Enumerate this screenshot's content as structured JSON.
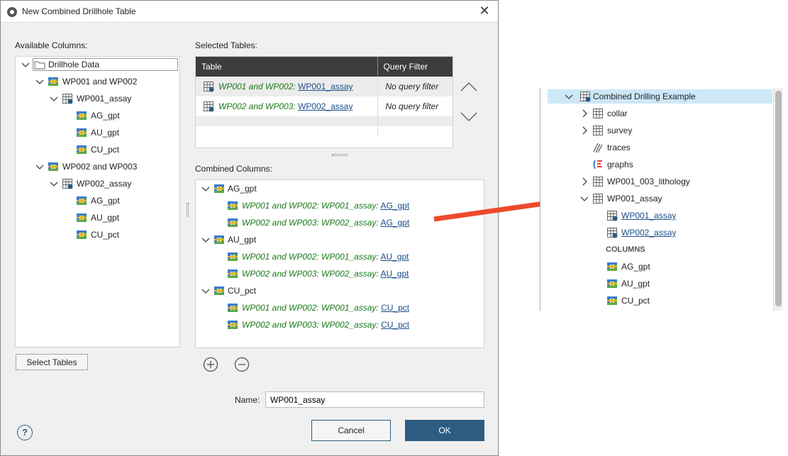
{
  "dialog": {
    "title": "New Combined Drillhole Table",
    "available_label": "Available Columns:",
    "selected_label": "Selected Tables:",
    "combined_label": "Combined Columns:",
    "name_label": "Name:",
    "name_value": "WP001_assay",
    "select_tables": "Select Tables",
    "cancel": "Cancel",
    "ok": "OK",
    "help": "?"
  },
  "available_tree": {
    "root": "Drillhole Data",
    "groups": [
      {
        "label": "WP001 and WP002",
        "table": "WP001_assay",
        "cols": [
          "AG_gpt",
          "AU_gpt",
          "CU_pct"
        ]
      },
      {
        "label": "WP002 and WP003",
        "table": "WP002_assay",
        "cols": [
          "AG_gpt",
          "AU_gpt",
          "CU_pct"
        ]
      }
    ]
  },
  "selected_table": {
    "headers": [
      "Table",
      "Query Filter"
    ],
    "rows": [
      {
        "prefix": "WP001 and WP002:",
        "link": "WP001_assay",
        "filter": "No query filter"
      },
      {
        "prefix": "WP002 and WP003:",
        "link": "WP002_assay",
        "filter": "No query filter"
      }
    ]
  },
  "combined": [
    {
      "name": "AG_gpt",
      "items": [
        {
          "prefix": "WP001 and WP002: WP001_assay:",
          "link": "AG_gpt"
        },
        {
          "prefix": "WP002 and WP003: WP002_assay:",
          "link": "AG_gpt"
        }
      ]
    },
    {
      "name": "AU_gpt",
      "items": [
        {
          "prefix": "WP001 and WP002: WP001_assay:",
          "link": "AU_gpt"
        },
        {
          "prefix": "WP002 and WP003: WP002_assay:",
          "link": "AU_gpt"
        }
      ]
    },
    {
      "name": "CU_pct",
      "items": [
        {
          "prefix": "WP001 and WP002: WP001_assay:",
          "link": "CU_pct"
        },
        {
          "prefix": "WP002 and WP003: WP002_assay:",
          "link": "CU_pct"
        }
      ]
    }
  ],
  "project": {
    "root": "Combined Drilling Example",
    "items": [
      "collar",
      "survey",
      "traces",
      "graphs",
      "WP001_003_lithology",
      "WP001_assay"
    ],
    "sub_links": [
      "WP001_assay",
      "WP002_assay"
    ],
    "columns_header": "COLUMNS",
    "cols": [
      "AG_gpt",
      "AU_gpt",
      "CU_pct"
    ]
  },
  "colors": {
    "accent": "#2c5c82",
    "arrow": "#ee4b2b",
    "selected_row": "#cde8f7",
    "green_text": "#1a7a1a"
  }
}
